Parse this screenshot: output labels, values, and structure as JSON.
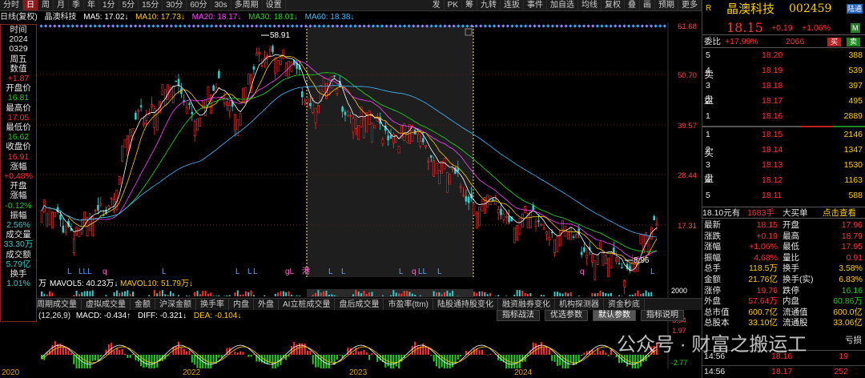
{
  "toolbar": {
    "items": [
      "分时",
      "日",
      "周",
      "月",
      "季",
      "年",
      "1分",
      "5分",
      "15分",
      "30分",
      "60分",
      "30s",
      "多周期",
      "设置"
    ],
    "right": [
      "发",
      "PK",
      "筹",
      "九转",
      "连扳",
      "事件",
      "加自选",
      "均线",
      "复权",
      "叠",
      "画",
      "预期",
      "更多"
    ],
    "active_index": 1
  },
  "ma_legend": {
    "label": "日线(复权)",
    "name": "晶澳科技",
    "ma5": "MA5: 17.02↓",
    "ma10": "MA10: 17.73↓",
    "ma20": "MA20: 18.17↓",
    "ma30": "MA30: 18.01↓",
    "ma60": "MA60: 18.38↓"
  },
  "info": [
    {
      "t": "时间",
      "c": "white"
    },
    {
      "t": "2024",
      "c": "white"
    },
    {
      "t": "0329",
      "c": "white"
    },
    {
      "t": "周五",
      "c": "white"
    },
    {
      "t": "数值",
      "c": "white"
    },
    {
      "t": "+1.87",
      "c": "red"
    },
    {
      "t": "开盘价",
      "c": "white"
    },
    {
      "t": "16.81",
      "c": "green"
    },
    {
      "t": "最高价",
      "c": "white"
    },
    {
      "t": "17.05",
      "c": "red"
    },
    {
      "t": "最低价",
      "c": "white"
    },
    {
      "t": "16.62",
      "c": "green"
    },
    {
      "t": "收盘价",
      "c": "white"
    },
    {
      "t": "16.91",
      "c": "red"
    },
    {
      "t": "涨幅",
      "c": "white"
    },
    {
      "t": "+0.48%",
      "c": "red"
    },
    {
      "t": "开盘",
      "c": "white"
    },
    {
      "t": "涨幅",
      "c": "white"
    },
    {
      "t": "-0.12%",
      "c": "green"
    },
    {
      "t": "振幅",
      "c": "white"
    },
    {
      "t": "2.56%",
      "c": "cyan"
    },
    {
      "t": "成交量",
      "c": "white"
    },
    {
      "t": "33.30万",
      "c": "cyan"
    },
    {
      "t": "成交额",
      "c": "white"
    },
    {
      "t": "5.79亿",
      "c": "cyan"
    },
    {
      "t": "换手",
      "c": "white"
    },
    {
      "t": "1.01%",
      "c": "cyan"
    }
  ],
  "price_axis": [
    "61.68",
    "50.70",
    "39.57",
    "28.44",
    "17.31"
  ],
  "chart_labels": {
    "high": "58.91",
    "low": "8.96",
    "vol_label": "万",
    "mavol5": "MAVOL5: 40.23万↓",
    "mavol10": "MAVOL10: 51.79万↓",
    "vol_axis": "2000"
  },
  "markers": [
    "L",
    "LLL",
    "q",
    "L",
    "L",
    "L",
    "L",
    "gL",
    "港",
    "L",
    "L",
    "L",
    "q",
    "LL",
    "L",
    "q",
    "L"
  ],
  "tabs": [
    "全景",
    "多周期成交量",
    "虚拟成交量",
    "金额",
    "沪深金额",
    "换手率",
    "内盘",
    "外盘",
    "AI立桩成交量",
    "盘后成交量",
    "市盈率(ttm)",
    "陆股通持股变化",
    "融资融券变化",
    "机构探测器",
    "资金秒底"
  ],
  "tabs_active": 0,
  "macd": {
    "params": "(12,26,9)",
    "macd": "MACD: -0.434↑",
    "diff": "DIFF: -0.321↓",
    "dea": "DEA: -0.104↓",
    "axis_top": "3.94",
    "axis_mid": "1.97",
    "axis_bot": "-2.77"
  },
  "sub_buttons": [
    "指标战法",
    "优选参数",
    "默认参数",
    "指标说明"
  ],
  "years": [
    "2020",
    "2022",
    "2023",
    "2024"
  ],
  "right": {
    "flag": "R",
    "name": "晶澳科技",
    "code": "002459",
    "board": "陆通",
    "price": "18.15",
    "chg": "+0.19",
    "pct": "+1.06%",
    "one": "M",
    "webi_label": "委比",
    "webi": "+17.99%",
    "wecha": "2066",
    "btn_buy": "买",
    "btn_sell": "卖",
    "sell_tag": [
      "卖",
      "盘"
    ],
    "buy_tag": [
      "买",
      "盘"
    ],
    "asks": [
      {
        "n": "5",
        "p": "18.20",
        "v": "388"
      },
      {
        "n": "4",
        "p": "18.19",
        "v": "539"
      },
      {
        "n": "3",
        "p": "18.18",
        "v": "397"
      },
      {
        "n": "2",
        "p": "18.17",
        "v": "495"
      },
      {
        "n": "1",
        "p": "18.16",
        "v": "2889"
      }
    ],
    "bids": [
      {
        "n": "1",
        "p": "18.15",
        "v": "2146"
      },
      {
        "n": "2",
        "p": "18.14",
        "v": "1347"
      },
      {
        "n": "3",
        "p": "18.13",
        "v": "1530"
      },
      {
        "n": "4",
        "p": "18.12",
        "v": "1163"
      },
      {
        "n": "5",
        "p": "18.11",
        "v": "588"
      }
    ],
    "banner": [
      "18.10元有",
      "1683手",
      "大买单",
      "点击查看"
    ],
    "stats": [
      {
        "l": "最新",
        "v": "18.15",
        "vc": "red",
        "l2": "开盘",
        "v2": "17.96",
        "v2c": "red"
      },
      {
        "l": "涨跌",
        "v": "+0.19",
        "vc": "red",
        "l2": "最高",
        "v2": "18.79",
        "v2c": "red"
      },
      {
        "l": "涨幅",
        "v": "+1.06%",
        "vc": "red",
        "l2": "最低",
        "v2": "17.95",
        "v2c": "red"
      },
      {
        "l": "振幅",
        "v": "4.68%",
        "vc": "red",
        "l2": "量比",
        "v2": "0.91",
        "v2c": "red"
      },
      {
        "l": "总手",
        "v": "118.5万",
        "vc": "yellow",
        "l2": "换手",
        "v2": "3.58%",
        "v2c": "yellow"
      },
      {
        "l": "金额",
        "v": "21.76亿",
        "vc": "yellow",
        "l2": "换手(实)",
        "v2": "6.83%",
        "v2c": "yellow"
      },
      {
        "l": "涨停",
        "v": "19.76",
        "vc": "red",
        "l2": "跌停",
        "v2": "16.16",
        "v2c": "green"
      },
      {
        "l": "外盘",
        "v": "57.64万",
        "vc": "red",
        "l2": "内盘",
        "v2": "60.86万",
        "v2c": "green"
      },
      {
        "l": "总市值",
        "v": "600.7亿",
        "vc": "yellow",
        "l2": "流通值",
        "v2": "600.0亿",
        "v2c": "yellow"
      },
      {
        "l": "总股本",
        "v": "33.10亿",
        "vc": "yellow",
        "l2": "流通股",
        "v2": "33.06亿",
        "v2c": "yellow"
      }
    ],
    "extra": "亏损",
    "ticks": [
      {
        "t": "14:56",
        "p": "18.16",
        "v": "19"
      },
      {
        "t": "14:56",
        "p": "18.17",
        "v": "252"
      }
    ]
  },
  "watermark": "公众号 · 财富之搬运工"
}
